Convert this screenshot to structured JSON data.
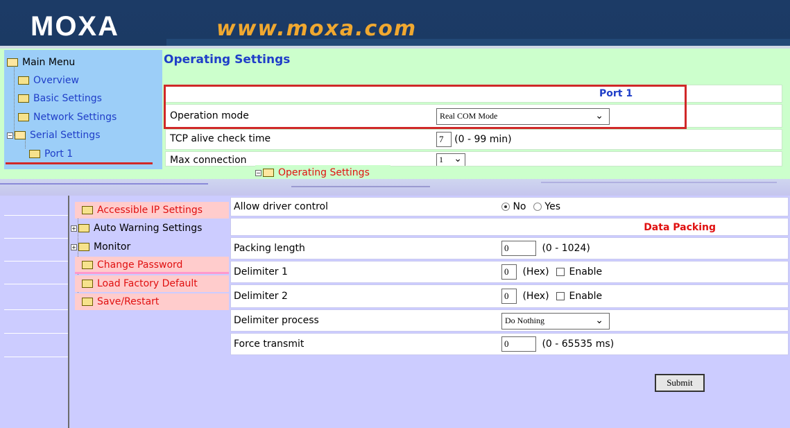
{
  "header": {
    "logo": "MOXA",
    "url": "www.moxa.com"
  },
  "top_menu": {
    "root": "Main Menu",
    "items": [
      "Overview",
      "Basic Settings",
      "Network Settings",
      "Serial Settings",
      "Port 1"
    ]
  },
  "operating": {
    "title": "Operating Settings",
    "port_header": "Port 1",
    "rows": [
      {
        "label": "Operation mode",
        "value": "Real COM Mode"
      },
      {
        "label": "TCP alive check time",
        "value": "7",
        "hint": "(0 - 99 min)"
      },
      {
        "label": "Max connection",
        "value": "1"
      }
    ]
  },
  "drag_label": "Operating Settings",
  "sub_menu": {
    "items": [
      {
        "label": "Accessible IP Settings"
      },
      {
        "label": "Auto Warning Settings"
      },
      {
        "label": "Monitor"
      },
      {
        "label": "Change Password"
      },
      {
        "label": "Load Factory Default"
      },
      {
        "label": "Save/Restart"
      }
    ]
  },
  "form": {
    "allow_driver_control": {
      "label": "Allow driver control",
      "no": "No",
      "yes": "Yes",
      "selected": "No"
    },
    "data_packing_header": "Data Packing",
    "packing_length": {
      "label": "Packing length",
      "value": "0",
      "hint": "(0 - 1024)"
    },
    "delimiter1": {
      "label": "Delimiter 1",
      "value": "0",
      "hex": "(Hex)",
      "enable": "Enable"
    },
    "delimiter2": {
      "label": "Delimiter 2",
      "value": "0",
      "hex": "(Hex)",
      "enable": "Enable"
    },
    "delimiter_process": {
      "label": "Delimiter process",
      "value": "Do Nothing"
    },
    "force_transmit": {
      "label": "Force transmit",
      "value": "0",
      "hint": "(0 - 65535 ms)"
    },
    "submit": "Submit"
  },
  "colors": {
    "header_bg": "#1c3b66",
    "url_orange": "#f0a830",
    "highlight_red": "#d02828"
  }
}
